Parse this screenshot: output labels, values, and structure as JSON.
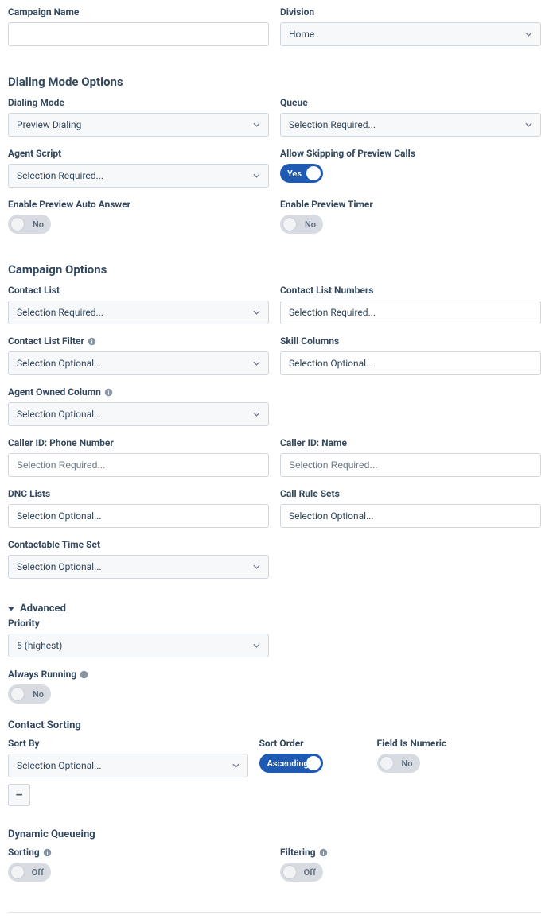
{
  "campaign_name": {
    "label": "Campaign Name"
  },
  "division": {
    "label": "Division",
    "value": "Home"
  },
  "dialing_mode_options": {
    "heading": "Dialing Mode Options",
    "dialing_mode": {
      "label": "Dialing Mode",
      "value": "Preview Dialing"
    },
    "queue": {
      "label": "Queue",
      "value": "Selection Required..."
    },
    "agent_script": {
      "label": "Agent Script",
      "value": "Selection Required..."
    },
    "allow_skipping": {
      "label": "Allow Skipping of Preview Calls",
      "value": "Yes"
    },
    "enable_auto_answer": {
      "label": "Enable Preview Auto Answer",
      "value": "No"
    },
    "enable_preview_timer": {
      "label": "Enable Preview Timer",
      "value": "No"
    }
  },
  "campaign_options": {
    "heading": "Campaign Options",
    "contact_list": {
      "label": "Contact List",
      "value": "Selection Required..."
    },
    "contact_list_numbers": {
      "label": "Contact List Numbers",
      "value": "Selection Required..."
    },
    "contact_list_filter": {
      "label": "Contact List Filter",
      "value": "Selection Optional..."
    },
    "skill_columns": {
      "label": "Skill Columns",
      "value": "Selection Optional..."
    },
    "agent_owned_column": {
      "label": "Agent Owned Column",
      "value": "Selection Optional..."
    },
    "caller_id_phone": {
      "label": "Caller ID: Phone Number",
      "placeholder": "Selection Required..."
    },
    "caller_id_name": {
      "label": "Caller ID: Name",
      "placeholder": "Selection Required..."
    },
    "dnc_lists": {
      "label": "DNC Lists",
      "value": "Selection Optional..."
    },
    "call_rule_sets": {
      "label": "Call Rule Sets",
      "value": "Selection Optional..."
    },
    "contactable_time_set": {
      "label": "Contactable Time Set",
      "value": "Selection Optional..."
    }
  },
  "advanced": {
    "heading": "Advanced",
    "priority": {
      "label": "Priority",
      "value": "5 (highest)"
    },
    "always_running": {
      "label": "Always Running",
      "value": "No"
    }
  },
  "contact_sorting": {
    "heading": "Contact Sorting",
    "sort_by": {
      "label": "Sort By",
      "value": "Selection Optional..."
    },
    "sort_order": {
      "label": "Sort Order",
      "value": "Ascending"
    },
    "field_numeric": {
      "label": "Field Is Numeric",
      "value": "No"
    },
    "remove": "–"
  },
  "dynamic_queueing": {
    "heading": "Dynamic Queueing",
    "sorting": {
      "label": "Sorting",
      "value": "Off"
    },
    "filtering": {
      "label": "Filtering",
      "value": "Off"
    }
  }
}
